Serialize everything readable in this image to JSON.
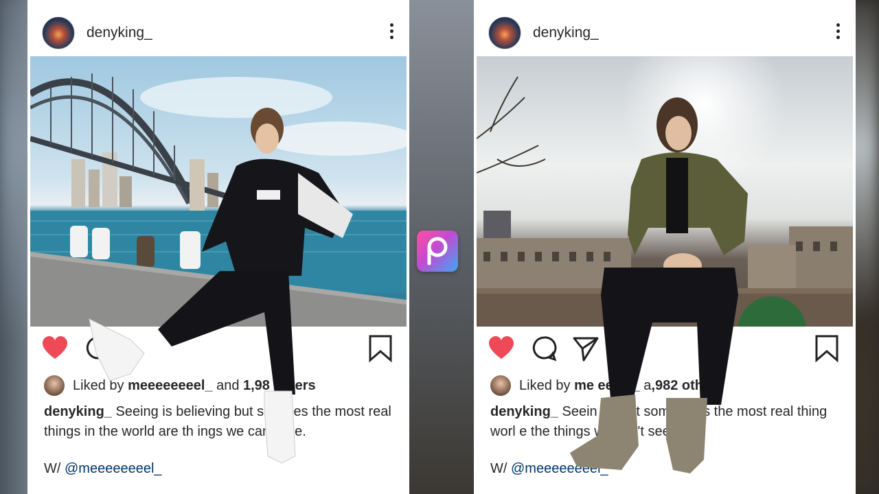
{
  "posts": [
    {
      "username": "denyking_",
      "liked_prefix": "Liked by ",
      "liked_user": "meeeeeeeel_",
      "liked_mid": " and ",
      "liked_count": "1,98",
      "liked_suffix": " others",
      "caption_user": "denyking_",
      "caption_text": " Seeing is believing but s  etimes the most real things in the world are th  ings we can't see.",
      "mention_prefix": "W/ ",
      "mention": "@meeeeeeeel_"
    },
    {
      "username": "denyking_",
      "liked_prefix": "Liked by ",
      "liked_user": "me    eeeel_",
      "liked_mid": " a",
      "liked_count": ",982",
      "liked_suffix": " others",
      "caption_user": "denyking_",
      "caption_text": " Seein    elievi     t sometimes the most real thing     worl    e the things we can't see.",
      "mention_prefix": "W/ ",
      "mention": "@meeeeeeeel_"
    }
  ],
  "icons": {
    "heart": "heart-icon",
    "comment": "comment-icon",
    "share": "share-icon",
    "bookmark": "bookmark-icon",
    "more": "more-icon"
  },
  "colors": {
    "heart": "#ed4956",
    "mention": "#003569",
    "text": "#262626"
  }
}
